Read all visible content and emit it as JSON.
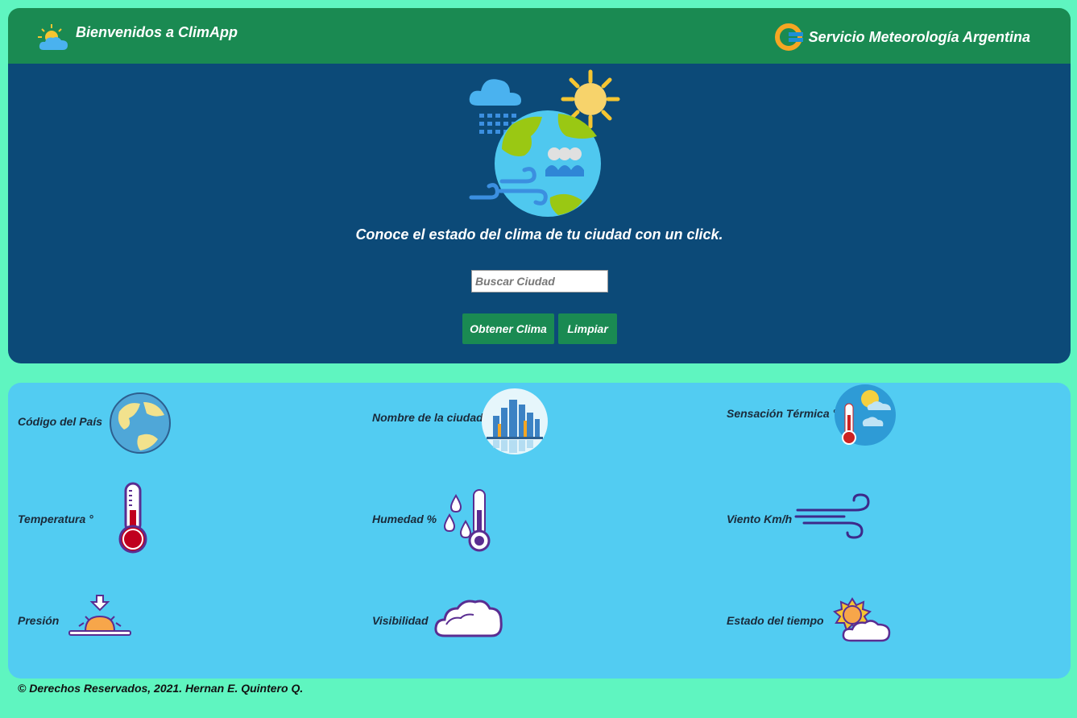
{
  "header": {
    "app_title": "Bienvenidos a ClimApp",
    "partner_title": "Servicio Meteorología Argentina"
  },
  "hero": {
    "tagline": "Conoce el estado del clima de tu ciudad con un click."
  },
  "search": {
    "placeholder": "Buscar Ciudad",
    "value": ""
  },
  "buttons": {
    "get_weather": "Obtener Clima",
    "clear": "Limpiar"
  },
  "weather_fields": {
    "country_code": "Código del País",
    "city_name": "Nombre de la ciudad",
    "feels_like": "Sensación Térmica °",
    "temperature": "Temperatura °",
    "humidity": "Humedad %",
    "wind": "Viento Km/h",
    "pressure": "Presión",
    "visibility": "Visibilidad",
    "weather_state": "Estado del tiempo"
  },
  "footer": {
    "copyright": "© Derechos Reservados, 2021. Hernan E. Quintero Q."
  },
  "icons": {
    "logo": "sun-cloud-icon",
    "partner_logo": "smn-logo-icon",
    "hero": "weather-globe-illustration",
    "country": "globe-icon",
    "city": "city-skyline-icon",
    "feels_like": "thermometer-sun-icon",
    "temperature": "thermometer-icon",
    "humidity": "humidity-thermometer-icon",
    "wind": "wind-icon",
    "pressure": "pressure-sun-icon",
    "visibility": "cloud-icon",
    "weather_state": "sun-cloud-icon"
  },
  "colors": {
    "page_bg": "#5ff5c0",
    "header_bg": "#1a8a52",
    "hero_bg": "#0c4a78",
    "panel_bg": "#52ccf2",
    "button_bg": "#1a8a52"
  }
}
